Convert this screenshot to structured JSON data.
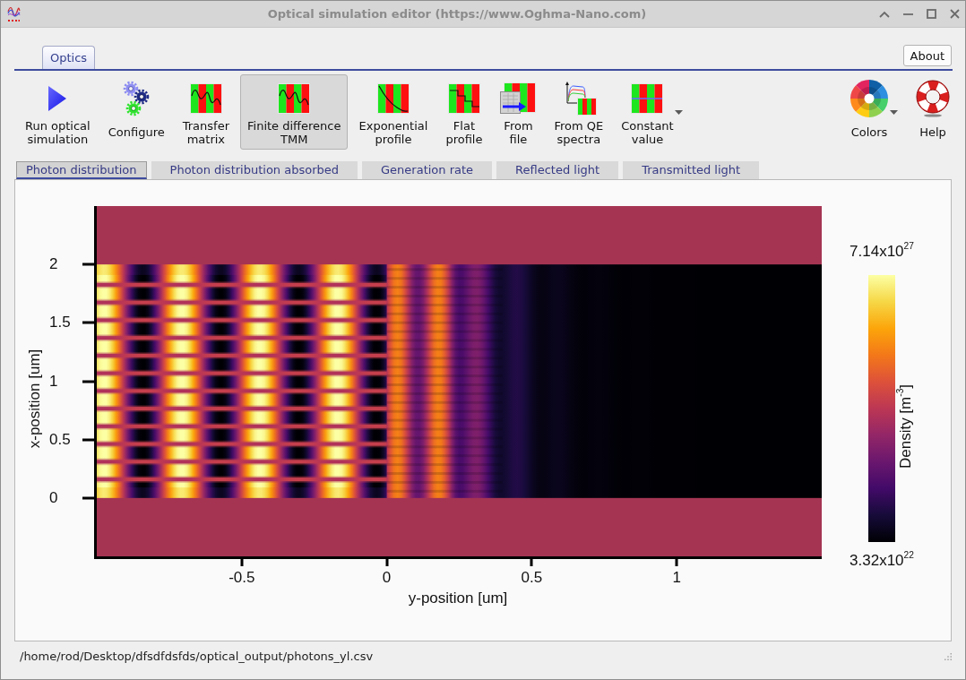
{
  "window": {
    "title": "Optical simulation editor (https://www.Oghma-Nano.com)"
  },
  "ribbon_tabs": [
    {
      "label": "Optics",
      "selected": true
    }
  ],
  "about_button": {
    "label": "About"
  },
  "toolbar": {
    "actions": [
      {
        "label": "Run optical\nsimulation"
      },
      {
        "label": "Configure"
      }
    ],
    "methods": [
      {
        "label": "Transfer\nmatrix",
        "selected": false,
        "menu": false
      },
      {
        "label": "Finite difference\nTMM",
        "selected": true,
        "menu": false
      },
      {
        "label": "Exponential\nprofile",
        "selected": false,
        "menu": false
      },
      {
        "label": "Flat\nprofile",
        "selected": false,
        "menu": false
      },
      {
        "label": "From\nfile",
        "selected": false,
        "menu": false
      },
      {
        "label": "From QE\nspectra",
        "selected": false,
        "menu": false
      },
      {
        "label": "Constant\nvalue",
        "selected": false,
        "menu": true
      }
    ],
    "tools": [
      {
        "label": "Colors",
        "menu": true
      },
      {
        "label": "Help",
        "menu": false
      }
    ]
  },
  "view_tabs": [
    {
      "label": "Photon distribution",
      "selected": true
    },
    {
      "label": "Photon distribution absorbed",
      "selected": false
    },
    {
      "label": "Generation rate",
      "selected": false
    },
    {
      "label": "Reflected light",
      "selected": false
    },
    {
      "label": "Transmitted light",
      "selected": false
    }
  ],
  "plot": {
    "y_axis": {
      "label": "x-position [um]",
      "ticks": [
        "2",
        "1.5",
        "1",
        "0.5",
        "0"
      ]
    },
    "x_axis": {
      "label": "y-position [um]",
      "ticks": [
        "-0.5",
        "0",
        "0.5",
        "1"
      ]
    },
    "colorbar": {
      "max_label": "7.14x10$^{27}$",
      "title": "Density [m$^{-3}$]",
      "min_label": "3.32x10$^{22}$"
    }
  },
  "status_bar": {
    "path": "/home/rod/Desktop/dfsdfdsfds/optical_output/photons_yl.csv"
  }
}
